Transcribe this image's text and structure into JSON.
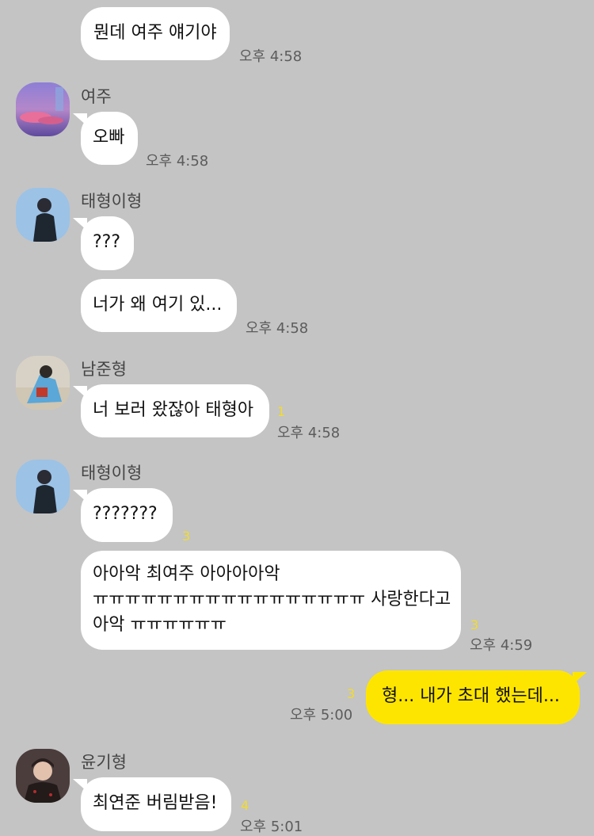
{
  "messages": {
    "m1": {
      "text": "뭔데 여주 얘기야",
      "time": "오후 4:58"
    },
    "m2": {
      "sender": "여주",
      "avatar": "sky-photo-avatar",
      "text": "오빠",
      "time": "오후 4:58"
    },
    "m3": {
      "sender": "태형이형",
      "avatar": "person-photo-avatar",
      "texts": [
        "???",
        "너가 왜 여기 있..."
      ],
      "time": "오후 4:58"
    },
    "m4": {
      "sender": "남준형",
      "avatar": "person-photo-avatar",
      "text": "너 보러 왔잖아 태형아",
      "unread": "1",
      "time": "오후 4:58"
    },
    "m5": {
      "sender": "태형이형",
      "avatar": "person-photo-avatar",
      "text1": "???????",
      "unread1": "3",
      "text2_lines": [
        "아아악 최여주 아아아아악",
        "ㅠㅠㅠㅠㅠㅠㅠㅠㅠㅠㅠㅠㅠㅠㅠㅠㅠ 사랑한다고",
        "아악 ㅠㅠㅠㅠㅠㅠ"
      ],
      "unread2": "3",
      "time": "오후 4:59"
    },
    "m6": {
      "text": "형... 내가 초대 했는데...",
      "unread": "3",
      "time": "오후 5:00",
      "mine": true
    },
    "m7": {
      "sender": "윤기형",
      "avatar": "person-photo-avatar",
      "text": "최연준 버림받음!",
      "unread": "4",
      "time": "오후 5:01"
    }
  },
  "colors": {
    "background": "#c4c4c4",
    "my_bubble": "#fee500",
    "other_bubble": "#ffffff",
    "unread": "#f3dc2a"
  }
}
